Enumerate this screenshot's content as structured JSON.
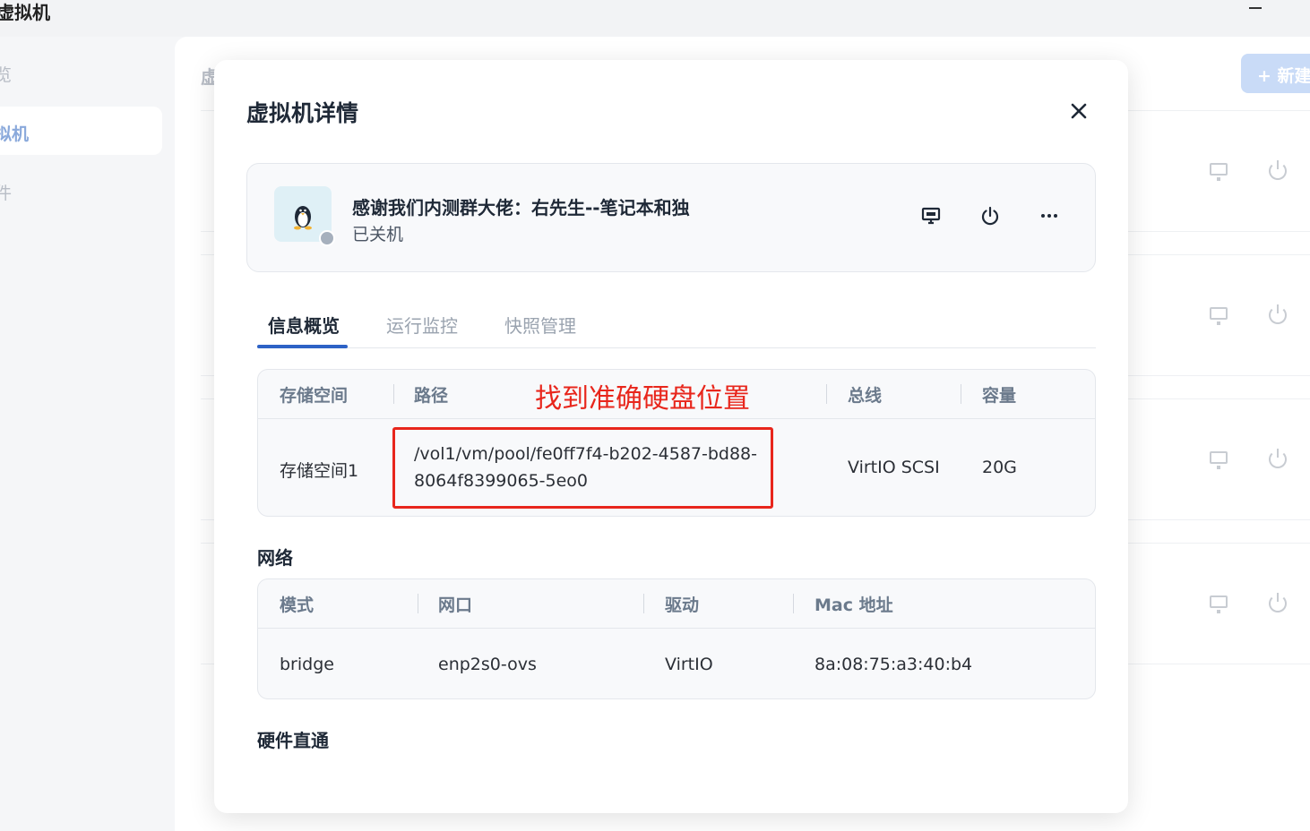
{
  "app": {
    "title": "虚拟机"
  },
  "sidebar": {
    "items": [
      {
        "label": "览",
        "active": false
      },
      {
        "label": "拟机",
        "active": true
      },
      {
        "label": "件",
        "active": false
      }
    ]
  },
  "content": {
    "heading": "虚",
    "new_button": "+ 新建"
  },
  "modal": {
    "title": "虚拟机详情",
    "vm": {
      "name": "感谢我们内测群大佬：右先生--笔记本和独",
      "status": "已关机"
    },
    "tabs": [
      "信息概览",
      "运行监控",
      "快照管理"
    ],
    "storage": {
      "headers": [
        "存储空间",
        "路径",
        "总线",
        "容量"
      ],
      "row": {
        "space": "存储空间1",
        "path_line1": "/vol1/vm/pool/fe0ff7f4-b202-4587-bd88-",
        "path_line2": "8064f8399065-5eo0",
        "bus": "VirtIO SCSI",
        "capacity": "20G"
      }
    },
    "annotation": "找到准确硬盘位置",
    "network": {
      "title": "网络",
      "headers": [
        "模式",
        "网口",
        "驱动",
        "Mac 地址"
      ],
      "row": {
        "mode": "bridge",
        "port": "enp2s0-ovs",
        "driver": "VirtIO",
        "mac": "8a:08:75:a3:40:b4"
      }
    },
    "passthrough": {
      "title": "硬件直通"
    }
  },
  "colors": {
    "accent": "#2d62c6",
    "annotation": "#e8261c",
    "status_off": "#a6b0bd"
  }
}
